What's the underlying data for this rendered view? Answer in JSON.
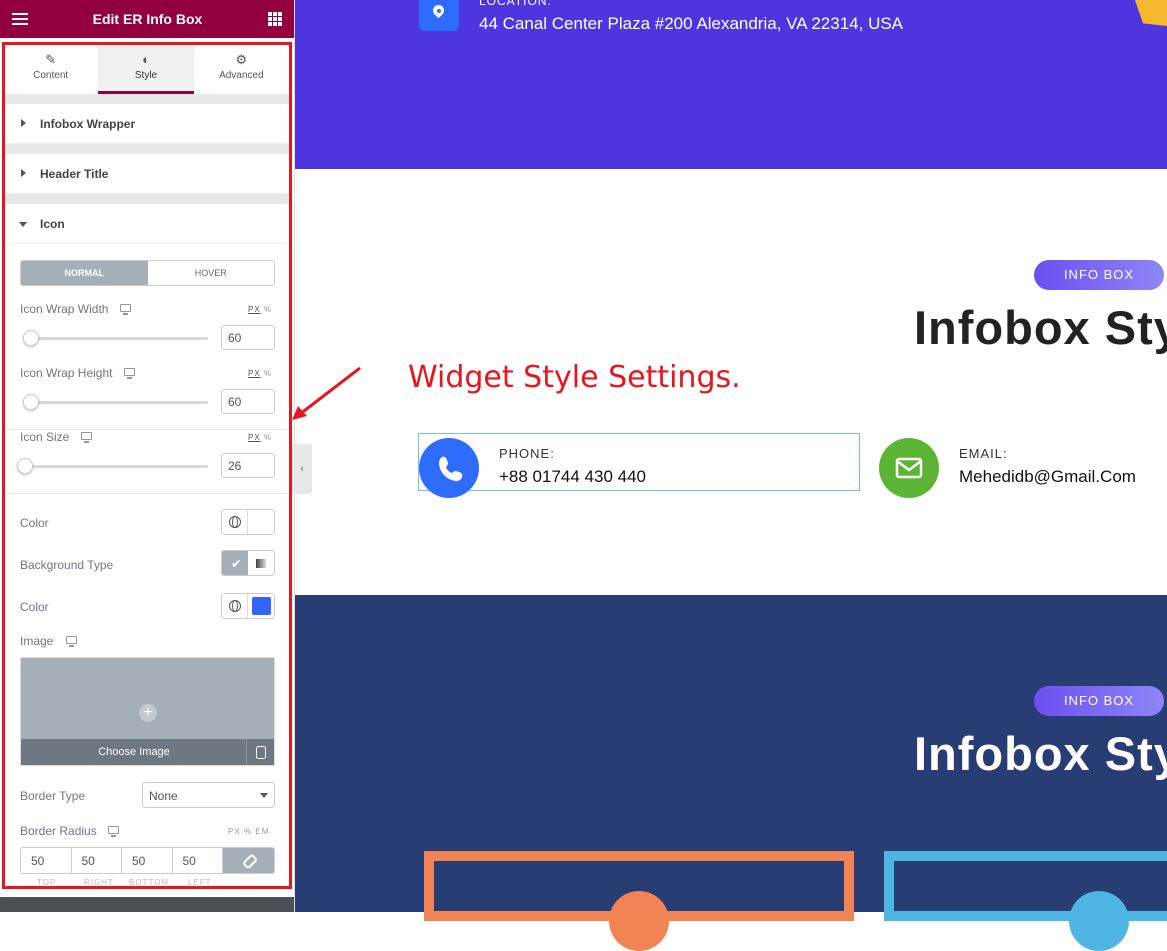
{
  "panel": {
    "title": "Edit ER Info Box",
    "tabs": [
      {
        "label": "Content",
        "icon": "pencil-icon"
      },
      {
        "label": "Style",
        "icon": "half-circle-icon"
      },
      {
        "label": "Advanced",
        "icon": "gear-icon"
      }
    ],
    "sections": {
      "wrapper": "Infobox Wrapper",
      "header": "Header Title",
      "icon": "Icon"
    },
    "state_switch": {
      "normal": "NORMAL",
      "hover": "HOVER"
    },
    "controls": {
      "wrap_width": {
        "label": "Icon Wrap Width",
        "value": "60",
        "unit_px": "PX",
        "unit_pct": "%"
      },
      "wrap_height": {
        "label": "Icon Wrap Height",
        "value": "60",
        "unit_px": "PX",
        "unit_pct": "%"
      },
      "icon_size": {
        "label": "Icon Size",
        "value": "26",
        "unit_px": "PX",
        "unit_pct": "%"
      },
      "color": {
        "label": "Color",
        "swatch": "#ffffff"
      },
      "background_type": {
        "label": "Background Type"
      },
      "bg_color": {
        "label": "Color",
        "swatch": "#3366ff"
      },
      "image": {
        "label": "Image",
        "choose": "Choose Image"
      },
      "border_type": {
        "label": "Border Type",
        "value": "None"
      },
      "border_radius": {
        "label": "Border Radius",
        "units": "PX % EM",
        "values": [
          "50",
          "50",
          "50",
          "50"
        ],
        "sides": [
          "TOP",
          "RIGHT",
          "BOTTOM",
          "LEFT"
        ]
      }
    }
  },
  "preview": {
    "location": {
      "label": "LOCATION:",
      "text": "44 Canal Center Plaza #200 Alexandria, VA 22314, USA"
    },
    "section1": {
      "badge": "INFO BOX",
      "heading": "Infobox Sty"
    },
    "annotation": "Widget Style Settings.",
    "phone": {
      "label": "PHONE:",
      "value": "+88 01744 430 440"
    },
    "email": {
      "label": "EMAIL:",
      "value": "Mehedidb@Gmail.Com"
    },
    "section2": {
      "badge": "INFO BOX",
      "heading": "Infobox Sty"
    }
  },
  "colors": {
    "panel_header": "#93003f",
    "annotation_red": "#e8151d",
    "top_band": "#4d35e0",
    "navy_band": "#283d73",
    "phone_icon": "#2e6bff",
    "email_icon": "#5bb533",
    "card_orange": "#f08455",
    "card_blue": "#4fb6e3"
  }
}
